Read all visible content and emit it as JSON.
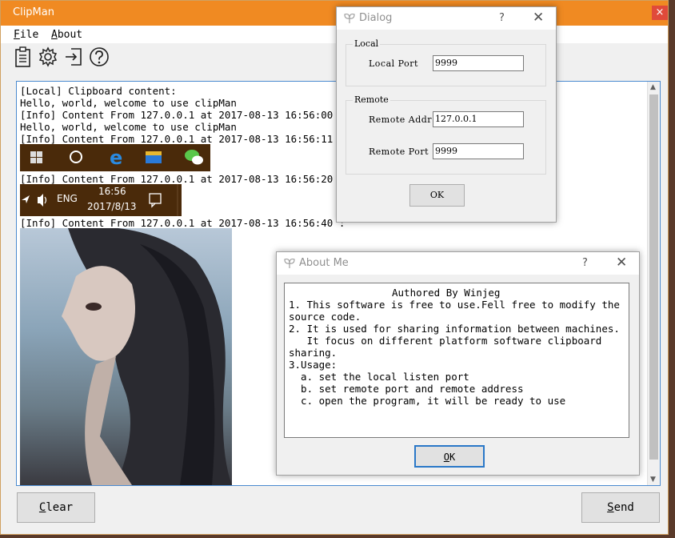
{
  "app": {
    "title": "ClipMan",
    "close_glyph": "×"
  },
  "menu": {
    "file": {
      "accel": "F",
      "rest": "ile"
    },
    "about": {
      "accel": "A",
      "rest": "bout"
    }
  },
  "toolbar": {
    "icons": [
      "clipboard-icon",
      "gear-icon",
      "exit-icon",
      "help-icon"
    ]
  },
  "log": {
    "lines": [
      "[Local] Clipboard content:",
      "Hello, world, welcome to use clipMan",
      "[Info] Content From 127.0.0.1 at 2017-08-13 16:56:00 :",
      "Hello, world, welcome to use clipMan",
      "[Info] Content From 127.0.0.1 at 2017-08-13 16:56:11 :",
      "[Info] Content From 127.0.0.1 at 2017-08-13 16:56:20 :",
      "[Info] Content From 127.0.0.1 at 2017-08-13 16:56:40 :"
    ],
    "taskbar_time": "16:56",
    "taskbar_date": "2017/8/13",
    "taskbar_lang": "ENG"
  },
  "buttons": {
    "clear": {
      "accel": "C",
      "rest": "lear"
    },
    "send": {
      "accel": "S",
      "rest": "end"
    }
  },
  "dialog": {
    "title": "Dialog",
    "help": "?",
    "close": "✕",
    "local_group": "Local",
    "local_port_label": "Local Port",
    "local_port_value": "9999",
    "remote_group": "Remote",
    "remote_addr_label": "Remote Addr",
    "remote_addr_value": "127.0.0.1",
    "remote_port_label": "Remote Port",
    "remote_port_value": "9999",
    "ok": "OK"
  },
  "about": {
    "title": "About Me",
    "help": "?",
    "close": "✕",
    "lines": [
      "Authored By Winjeg",
      "1. This software is free to use.Fell free to modify the",
      "source code.",
      "2. It is used for sharing information between machines.",
      "   It focus on different platform software clipboard",
      "sharing.",
      "3.Usage:",
      "  a. set the local listen port",
      "  b. set remote port and remote address",
      "  c. open the program, it will be ready to use"
    ],
    "ok_accel": "O",
    "ok_rest": "K"
  },
  "colors": {
    "titlebar": "#f08a22",
    "accent_border": "#4a8ad0",
    "taskbar_bg": "#4a2a0a"
  }
}
